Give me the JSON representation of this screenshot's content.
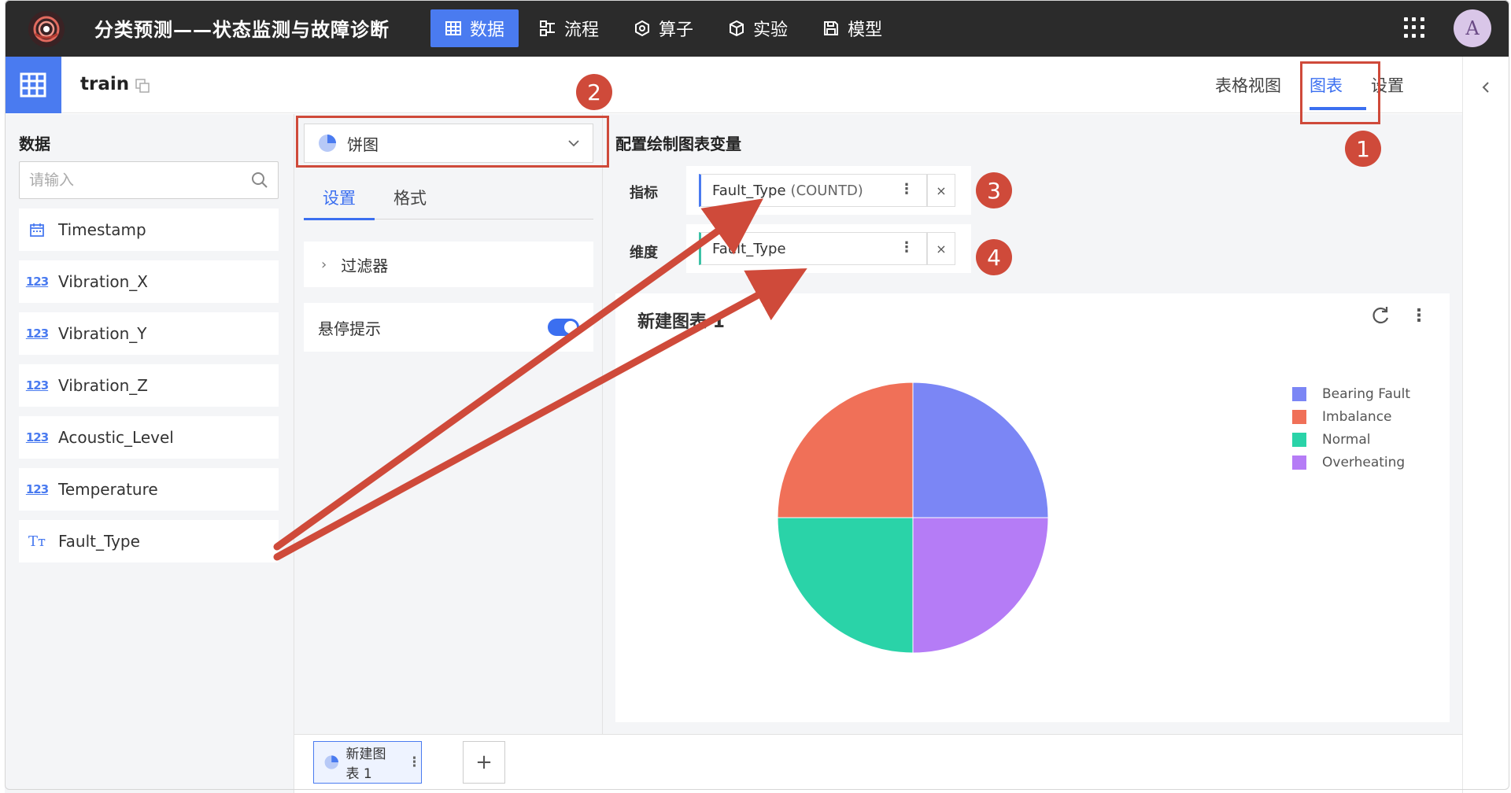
{
  "app": {
    "title": "分类预测——状态监测与故障诊断",
    "avatar_letter": "A"
  },
  "nav": [
    {
      "label": "数据",
      "icon": "table-icon",
      "active": true
    },
    {
      "label": "流程",
      "icon": "flow-icon",
      "active": false
    },
    {
      "label": "算子",
      "icon": "hexagon-icon",
      "active": false
    },
    {
      "label": "实验",
      "icon": "cube-icon",
      "active": false
    },
    {
      "label": "模型",
      "icon": "save-icon",
      "active": false
    }
  ],
  "dataset": {
    "name": "train"
  },
  "view_tabs": [
    {
      "label": "表格视图",
      "active": false
    },
    {
      "label": "图表",
      "active": true
    },
    {
      "label": "设置",
      "active": false
    }
  ],
  "data_panel": {
    "title": "数据",
    "search_placeholder": "请输入",
    "fields": [
      {
        "name": "Timestamp",
        "type": "date"
      },
      {
        "name": "Vibration_X",
        "type": "number"
      },
      {
        "name": "Vibration_Y",
        "type": "number"
      },
      {
        "name": "Vibration_Z",
        "type": "number"
      },
      {
        "name": "Acoustic_Level",
        "type": "number"
      },
      {
        "name": "Temperature",
        "type": "number"
      },
      {
        "name": "Fault_Type",
        "type": "text"
      }
    ],
    "number_icon_text": "123",
    "text_icon_text": "Tт"
  },
  "config_panel": {
    "chart_type": "饼图",
    "tabs": [
      {
        "label": "设置",
        "active": true
      },
      {
        "label": "格式",
        "active": false
      }
    ],
    "filter_label": "过滤器",
    "tooltip_label": "悬停提示",
    "tooltip_enabled": true
  },
  "chart_config": {
    "title": "配置绘制图表变量",
    "metric_label": "指标",
    "metric_field": "Fault_Type",
    "metric_agg": "(COUNTD)",
    "dimension_label": "维度",
    "dimension_field": "Fault_Type",
    "remove_symbol": "×",
    "more_symbol": "⋮"
  },
  "chart_card": {
    "title": "新建图表 1"
  },
  "bottom_tabs": {
    "chart_tab_label": "新建图表 1",
    "add_symbol": "+"
  },
  "annotations": {
    "badge_1": "1",
    "badge_2": "2",
    "badge_3": "3",
    "badge_4": "4"
  },
  "colors": {
    "accent": "#4a7bf0",
    "annotation_red": "#cf4a3a",
    "topbar": "#2b2b2b"
  },
  "chart_data": {
    "type": "pie",
    "categories": [
      "Bearing Fault",
      "Imbalance",
      "Normal",
      "Overheating"
    ],
    "values": [
      25,
      25,
      25,
      25
    ],
    "colors": [
      "#7b86f5",
      "#f07058",
      "#2ad3a8",
      "#b57cf6"
    ],
    "legend_position": "top-right"
  }
}
